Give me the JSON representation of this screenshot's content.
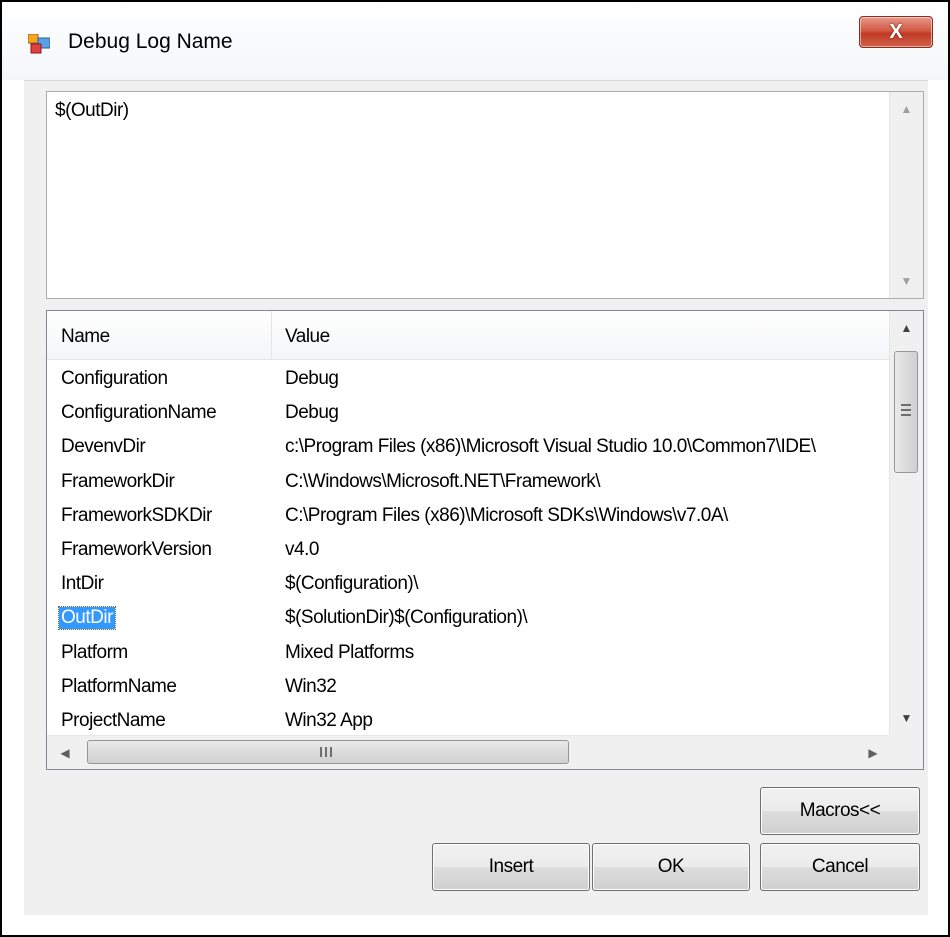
{
  "window": {
    "title": "Debug Log Name",
    "close_glyph": "X"
  },
  "editor": {
    "value": "$(OutDir)"
  },
  "macros_list": {
    "columns": [
      "Name",
      "Value"
    ],
    "rows": [
      {
        "name": "Configuration",
        "value": "Debug"
      },
      {
        "name": "ConfigurationName",
        "value": "Debug"
      },
      {
        "name": "DevenvDir",
        "value": "c:\\Program Files (x86)\\Microsoft Visual Studio 10.0\\Common7\\IDE\\"
      },
      {
        "name": "FrameworkDir",
        "value": "C:\\Windows\\Microsoft.NET\\Framework\\"
      },
      {
        "name": "FrameworkSDKDir",
        "value": "C:\\Program Files (x86)\\Microsoft SDKs\\Windows\\v7.0A\\"
      },
      {
        "name": "FrameworkVersion",
        "value": "v4.0"
      },
      {
        "name": "IntDir",
        "value": "$(Configuration)\\"
      },
      {
        "name": "OutDir",
        "value": "$(SolutionDir)$(Configuration)\\"
      },
      {
        "name": "Platform",
        "value": "Mixed Platforms"
      },
      {
        "name": "PlatformName",
        "value": "Win32"
      },
      {
        "name": "ProjectName",
        "value": "Win32 App"
      }
    ],
    "selected_row": 7
  },
  "buttons": {
    "macros": "Macros<<",
    "insert": "Insert",
    "ok": "OK",
    "cancel": "Cancel"
  },
  "icons": {
    "app": "dialog-app-icon",
    "close": "close-icon"
  }
}
